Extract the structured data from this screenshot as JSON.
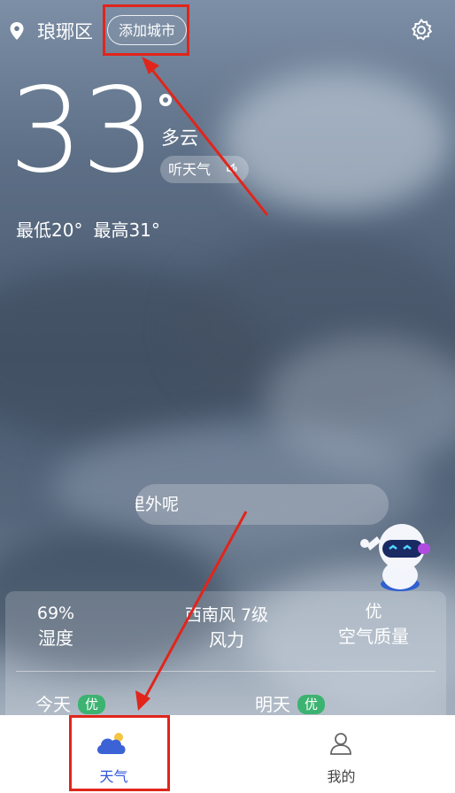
{
  "header": {
    "city": "琅琊区",
    "add_city_label": "添加城市"
  },
  "current": {
    "temperature": "33",
    "condition": "多云",
    "listen_label": "听天气",
    "low": "最低20°",
    "high": "最高31°"
  },
  "assistant": {
    "bubble_text": "里外呢"
  },
  "details": {
    "humidity_value": "69%",
    "humidity_label": "湿度",
    "wind_value": "西南风 7级",
    "wind_label": "风力",
    "aqi_value": "优",
    "aqi_label": "空气质量"
  },
  "forecast": {
    "today_label": "今天",
    "today_badge": "优",
    "tomorrow_label": "明天",
    "tomorrow_badge": "优"
  },
  "tabbar": {
    "weather_label": "天气",
    "mine_label": "我的"
  },
  "colors": {
    "accent_blue": "#2f56d8",
    "aqi_green": "#3cb371",
    "annotation_red": "#e1251b"
  },
  "icons": [
    "location-pin-icon",
    "settings-gear-icon",
    "speaker-icon",
    "robot-mascot",
    "cloud-weather-icon",
    "person-icon"
  ]
}
